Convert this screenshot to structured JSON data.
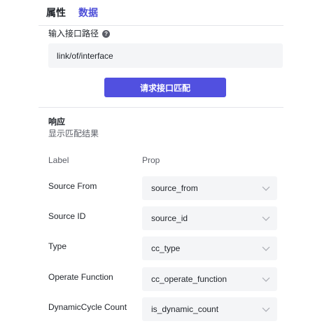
{
  "tabs": {
    "attributes": "属性",
    "data": "数据"
  },
  "interface": {
    "label": "输入接口路径",
    "help_icon": "question-circle-icon",
    "path_value": "link/of/interface",
    "match_button": "请求接口匹配"
  },
  "response": {
    "title": "响应",
    "subtitle": "显示匹配结果",
    "col_label": "Label",
    "col_prop": "Prop",
    "rows": [
      {
        "label": "Source From",
        "prop": "source_from"
      },
      {
        "label": "Source ID",
        "prop": "source_id"
      },
      {
        "label": "Type",
        "prop": "cc_type"
      },
      {
        "label": "Operate Function",
        "prop": "cc_operate_function"
      },
      {
        "label": "DynamicCycle Count",
        "prop": "is_dynamic_count"
      }
    ]
  },
  "colors": {
    "accent": "#5150e0",
    "active_tab": "#4e4fd8",
    "field_bg": "#f4f5f7"
  }
}
